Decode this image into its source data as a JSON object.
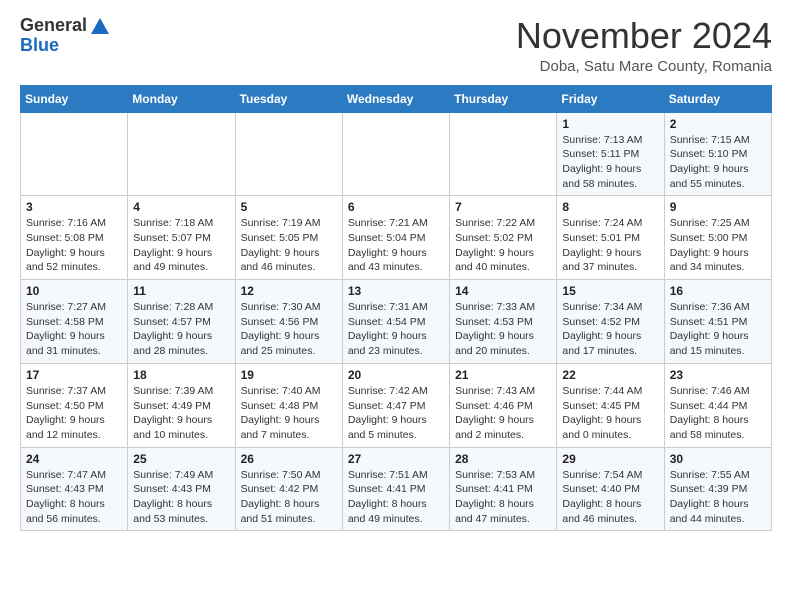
{
  "header": {
    "logo_line1": "General",
    "logo_line2": "Blue",
    "month_title": "November 2024",
    "location": "Doba, Satu Mare County, Romania"
  },
  "days_of_week": [
    "Sunday",
    "Monday",
    "Tuesday",
    "Wednesday",
    "Thursday",
    "Friday",
    "Saturday"
  ],
  "weeks": [
    [
      {
        "day": "",
        "info": ""
      },
      {
        "day": "",
        "info": ""
      },
      {
        "day": "",
        "info": ""
      },
      {
        "day": "",
        "info": ""
      },
      {
        "day": "",
        "info": ""
      },
      {
        "day": "1",
        "info": "Sunrise: 7:13 AM\nSunset: 5:11 PM\nDaylight: 9 hours and 58 minutes."
      },
      {
        "day": "2",
        "info": "Sunrise: 7:15 AM\nSunset: 5:10 PM\nDaylight: 9 hours and 55 minutes."
      }
    ],
    [
      {
        "day": "3",
        "info": "Sunrise: 7:16 AM\nSunset: 5:08 PM\nDaylight: 9 hours and 52 minutes."
      },
      {
        "day": "4",
        "info": "Sunrise: 7:18 AM\nSunset: 5:07 PM\nDaylight: 9 hours and 49 minutes."
      },
      {
        "day": "5",
        "info": "Sunrise: 7:19 AM\nSunset: 5:05 PM\nDaylight: 9 hours and 46 minutes."
      },
      {
        "day": "6",
        "info": "Sunrise: 7:21 AM\nSunset: 5:04 PM\nDaylight: 9 hours and 43 minutes."
      },
      {
        "day": "7",
        "info": "Sunrise: 7:22 AM\nSunset: 5:02 PM\nDaylight: 9 hours and 40 minutes."
      },
      {
        "day": "8",
        "info": "Sunrise: 7:24 AM\nSunset: 5:01 PM\nDaylight: 9 hours and 37 minutes."
      },
      {
        "day": "9",
        "info": "Sunrise: 7:25 AM\nSunset: 5:00 PM\nDaylight: 9 hours and 34 minutes."
      }
    ],
    [
      {
        "day": "10",
        "info": "Sunrise: 7:27 AM\nSunset: 4:58 PM\nDaylight: 9 hours and 31 minutes."
      },
      {
        "day": "11",
        "info": "Sunrise: 7:28 AM\nSunset: 4:57 PM\nDaylight: 9 hours and 28 minutes."
      },
      {
        "day": "12",
        "info": "Sunrise: 7:30 AM\nSunset: 4:56 PM\nDaylight: 9 hours and 25 minutes."
      },
      {
        "day": "13",
        "info": "Sunrise: 7:31 AM\nSunset: 4:54 PM\nDaylight: 9 hours and 23 minutes."
      },
      {
        "day": "14",
        "info": "Sunrise: 7:33 AM\nSunset: 4:53 PM\nDaylight: 9 hours and 20 minutes."
      },
      {
        "day": "15",
        "info": "Sunrise: 7:34 AM\nSunset: 4:52 PM\nDaylight: 9 hours and 17 minutes."
      },
      {
        "day": "16",
        "info": "Sunrise: 7:36 AM\nSunset: 4:51 PM\nDaylight: 9 hours and 15 minutes."
      }
    ],
    [
      {
        "day": "17",
        "info": "Sunrise: 7:37 AM\nSunset: 4:50 PM\nDaylight: 9 hours and 12 minutes."
      },
      {
        "day": "18",
        "info": "Sunrise: 7:39 AM\nSunset: 4:49 PM\nDaylight: 9 hours and 10 minutes."
      },
      {
        "day": "19",
        "info": "Sunrise: 7:40 AM\nSunset: 4:48 PM\nDaylight: 9 hours and 7 minutes."
      },
      {
        "day": "20",
        "info": "Sunrise: 7:42 AM\nSunset: 4:47 PM\nDaylight: 9 hours and 5 minutes."
      },
      {
        "day": "21",
        "info": "Sunrise: 7:43 AM\nSunset: 4:46 PM\nDaylight: 9 hours and 2 minutes."
      },
      {
        "day": "22",
        "info": "Sunrise: 7:44 AM\nSunset: 4:45 PM\nDaylight: 9 hours and 0 minutes."
      },
      {
        "day": "23",
        "info": "Sunrise: 7:46 AM\nSunset: 4:44 PM\nDaylight: 8 hours and 58 minutes."
      }
    ],
    [
      {
        "day": "24",
        "info": "Sunrise: 7:47 AM\nSunset: 4:43 PM\nDaylight: 8 hours and 56 minutes."
      },
      {
        "day": "25",
        "info": "Sunrise: 7:49 AM\nSunset: 4:43 PM\nDaylight: 8 hours and 53 minutes."
      },
      {
        "day": "26",
        "info": "Sunrise: 7:50 AM\nSunset: 4:42 PM\nDaylight: 8 hours and 51 minutes."
      },
      {
        "day": "27",
        "info": "Sunrise: 7:51 AM\nSunset: 4:41 PM\nDaylight: 8 hours and 49 minutes."
      },
      {
        "day": "28",
        "info": "Sunrise: 7:53 AM\nSunset: 4:41 PM\nDaylight: 8 hours and 47 minutes."
      },
      {
        "day": "29",
        "info": "Sunrise: 7:54 AM\nSunset: 4:40 PM\nDaylight: 8 hours and 46 minutes."
      },
      {
        "day": "30",
        "info": "Sunrise: 7:55 AM\nSunset: 4:39 PM\nDaylight: 8 hours and 44 minutes."
      }
    ]
  ]
}
